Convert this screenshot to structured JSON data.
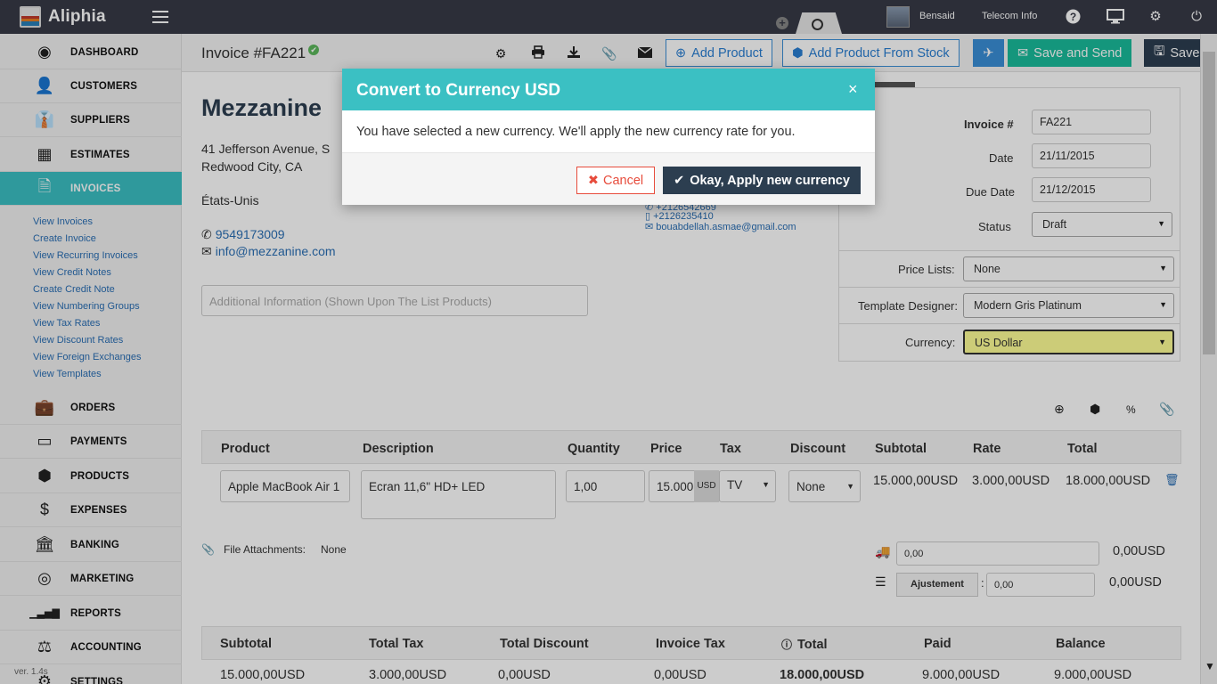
{
  "app": {
    "name": "Aliphia",
    "user": "Bensaid",
    "company": "Telecom Info"
  },
  "sidebar": {
    "items": [
      {
        "label": "DASHBOARD",
        "icon": "dashboard-icon",
        "glyph": "◉"
      },
      {
        "label": "CUSTOMERS",
        "icon": "user-icon",
        "glyph": "👤"
      },
      {
        "label": "SUPPLIERS",
        "icon": "supplier-icon",
        "glyph": "👔"
      },
      {
        "label": "ESTIMATES",
        "icon": "calculator-icon",
        "glyph": "▦"
      },
      {
        "label": "INVOICES",
        "icon": "document-icon",
        "glyph": "🗎"
      },
      {
        "label": "ORDERS",
        "icon": "briefcase-icon",
        "glyph": "💼"
      },
      {
        "label": "PAYMENTS",
        "icon": "credit-card-icon",
        "glyph": "▭"
      },
      {
        "label": "PRODUCTS",
        "icon": "cube-icon",
        "glyph": "⬢"
      },
      {
        "label": "EXPENSES",
        "icon": "dollar-icon",
        "glyph": "$"
      },
      {
        "label": "BANKING",
        "icon": "bank-icon",
        "glyph": "🏛"
      },
      {
        "label": "MARKETING",
        "icon": "target-icon",
        "glyph": "◎"
      },
      {
        "label": "REPORTS",
        "icon": "signal-bars-icon",
        "glyph": "▁▃▅▇"
      },
      {
        "label": "ACCOUNTING",
        "icon": "scale-icon",
        "glyph": "⚖"
      },
      {
        "label": "SETTINGS",
        "icon": "gear-icon",
        "glyph": "⚙"
      }
    ],
    "subitems": [
      "View Invoices",
      "Create Invoice",
      "View Recurring Invoices",
      "View Credit Notes",
      "Create Credit Note",
      "View Numbering Groups",
      "View Tax Rates",
      "View Discount Rates",
      "View Foreign Exchanges",
      "View Templates"
    ],
    "version": "ver. 1.4s"
  },
  "toolbar": {
    "title": "Invoice #FA221",
    "add_product": "Add Product",
    "add_from_stock": "Add Product From Stock",
    "save_send": "Save and Send",
    "save": "Save"
  },
  "client": {
    "name": "Mezzanine",
    "address1": "41 Jefferson Avenue, S",
    "address2": "Redwood City, CA",
    "country": "États-Unis",
    "phone": "9549173009",
    "email": "info@mezzanine.com",
    "additional_placeholder": "Additional Information (Shown Upon The List Products)",
    "contact_phone1": "+2126542669",
    "contact_phone2": "+2126235410",
    "contact_email": "bouabdellah.asmae@gmail.com"
  },
  "meta": {
    "invoice_label": "Invoice #",
    "invoice_value": "FA221",
    "date_label": "Date",
    "date_value": "21/11/2015",
    "due_label": "Due Date",
    "due_value": "21/12/2015",
    "status_label": "Status",
    "status_value": "Draft",
    "price_lists_label": "Price Lists:",
    "price_lists_value": "None",
    "template_label": "Template Designer:",
    "template_value": "Modern Gris Platinum",
    "currency_label": "Currency:",
    "currency_value": "US Dollar"
  },
  "items_table": {
    "headers": [
      "Product",
      "Description",
      "Quantity",
      "Price",
      "Tax",
      "Discount",
      "Subtotal",
      "Rate",
      "Total"
    ],
    "row": {
      "product": "Apple MacBook Air 1",
      "description": "Ecran 11,6\" HD+ LED",
      "quantity": "1,00",
      "price": "15.000",
      "price_unit": "USD",
      "tax": "TV",
      "discount": "None",
      "subtotal": "15.000,00USD",
      "rate": "3.000,00USD",
      "total": "18.000,00USD"
    }
  },
  "attachments": {
    "label": "File Attachments:",
    "value": "None"
  },
  "adjustments": {
    "shipping_input": "0,00",
    "shipping_total": "0,00USD",
    "adjust_label": "Ajustement",
    "adjust_input": "0,00",
    "adjust_total": "0,00USD"
  },
  "totals": {
    "headers": [
      "Subtotal",
      "Total Tax",
      "Total Discount",
      "Invoice Tax",
      "Total",
      "Paid",
      "Balance"
    ],
    "values": [
      "15.000,00USD",
      "3.000,00USD",
      "0,00USD",
      "0,00USD",
      "18.000,00USD",
      "9.000,00USD",
      "9.000,00USD"
    ]
  },
  "modal": {
    "title": "Convert to Currency USD",
    "close": "×",
    "body": "You have selected a new currency. We'll apply the new currency rate for you.",
    "cancel": "Cancel",
    "ok": "Okay, Apply new currency"
  },
  "colors": {
    "accent": "#3bc0c3",
    "topbar": "#373a47",
    "primary_dark": "#2c3e50",
    "success": "#1abc9c",
    "danger": "#e74c3c"
  }
}
